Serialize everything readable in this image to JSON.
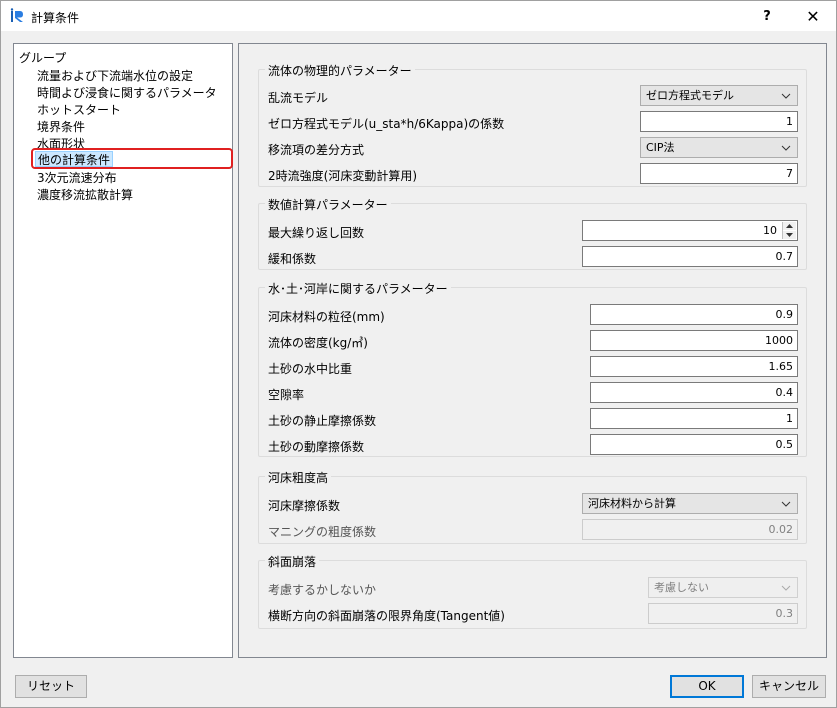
{
  "window": {
    "title": "計算条件",
    "help_label": "?",
    "close_label": "✕"
  },
  "tree": {
    "header": "グループ",
    "items": [
      {
        "label": "流量および下流端水位の設定",
        "selected": false
      },
      {
        "label": "時間よび浸食に関するパラメータ",
        "selected": false
      },
      {
        "label": "ホットスタート",
        "selected": false
      },
      {
        "label": "境界条件",
        "selected": false
      },
      {
        "label": "水面形状",
        "selected": false
      },
      {
        "label": "他の計算条件",
        "selected": true
      },
      {
        "label": "3次元流速分布",
        "selected": false
      },
      {
        "label": "濃度移流拡散計算",
        "selected": false
      }
    ]
  },
  "groups": {
    "fluid": {
      "title": "流体の物理的パラメーター",
      "turbulence_model_label": "乱流モデル",
      "turbulence_model_value": "ゼロ方程式モデル",
      "zero_eq_coef_label": "ゼロ方程式モデル(u_sta*h/6Kappa)の係数",
      "zero_eq_coef_value": "1",
      "advection_label": "移流項の差分方式",
      "advection_value": "CIP法",
      "secondary_flow_label": "2時流強度(河床変動計算用)",
      "secondary_flow_value": "7"
    },
    "numeric": {
      "title": "数値計算パラメーター",
      "max_iter_label": "最大繰り返し回数",
      "max_iter_value": "10",
      "relaxation_label": "緩和係数",
      "relaxation_value": "0.7"
    },
    "water_soil": {
      "title": "水･土･河岸に関するパラメーター",
      "grain_size_label": "河床材料の粒径(mm)",
      "grain_size_value": "0.9",
      "fluid_density_label": "流体の密度(kg/㎥)",
      "fluid_density_value": "1000",
      "submerged_sg_label": "土砂の水中比重",
      "submerged_sg_value": "1.65",
      "porosity_label": "空隙率",
      "porosity_value": "0.4",
      "static_friction_label": "土砂の静止摩擦係数",
      "static_friction_value": "1",
      "dynamic_friction_label": "土砂の動摩擦係数",
      "dynamic_friction_value": "0.5"
    },
    "roughness": {
      "title": "河床粗度高",
      "bed_friction_label": "河床摩擦係数",
      "bed_friction_value": "河床材料から計算",
      "manning_label": "マニングの粗度係数",
      "manning_value": "0.02"
    },
    "slope_failure": {
      "title": "斜面崩落",
      "consider_label": "考慮するかしないか",
      "consider_value": "考慮しない",
      "limit_angle_label": "横断方向の斜面崩落の限界角度(Tangent値)",
      "limit_angle_value": "0.3"
    }
  },
  "buttons": {
    "reset": "リセット",
    "ok": "OK",
    "cancel": "キャンセル"
  },
  "colors": {
    "selection_bg": "#cce8ff",
    "highlight_ring": "#e02020",
    "primary_border": "#0078d7"
  }
}
